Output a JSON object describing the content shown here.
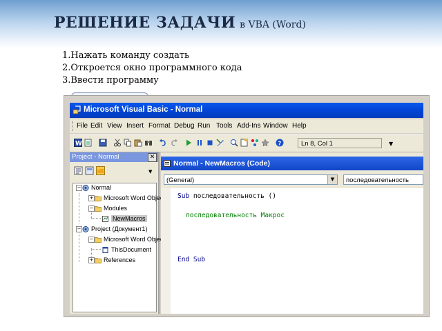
{
  "slide": {
    "title_main": "РЕШЕНИЕ ЗАДАЧИ",
    "title_sub": "в VBA (Word)",
    "steps": [
      "1.Нажать команду создать",
      "2.Откроется окно программного кода",
      "3.Ввести программу"
    ]
  },
  "window": {
    "title": "Microsoft Visual Basic - Normal",
    "menu": [
      "File",
      "Edit",
      "View",
      "Insert",
      "Format",
      "Debug",
      "Run",
      "Tools",
      "Add-Ins",
      "Window",
      "Help"
    ],
    "status_position": "Ln 8, Col 1"
  },
  "project_pane": {
    "title": "Project - Normal",
    "tree": [
      {
        "label": "Normal"
      },
      {
        "label": "Microsoft Word Objects"
      },
      {
        "label": "Modules"
      },
      {
        "label": "NewMacros"
      },
      {
        "label": "Project (Документ1)"
      },
      {
        "label": "Microsoft Word Objects"
      },
      {
        "label": "ThisDocument"
      },
      {
        "label": "References"
      }
    ]
  },
  "code_window": {
    "title": "Normal - NewMacros (Code)",
    "object_dropdown": "(General)",
    "procedure_dropdown": "последовательность",
    "lines": {
      "sub_kw": "Sub",
      "sub_rest": " последовательность ()",
      "comment": "последовательность Макрос",
      "end_kw": "End Sub"
    }
  },
  "colors": {
    "titlebar": "#0a58ec",
    "keyword": "#00008b",
    "comment": "#008000",
    "chrome": "#ece9d8"
  },
  "icons": [
    "vba-app-icon",
    "word-icon",
    "save-icon",
    "cut-icon",
    "copy-icon",
    "paste-icon",
    "find-icon",
    "undo-icon",
    "redo-icon",
    "run-icon",
    "pause-icon",
    "stop-icon",
    "design-mode-icon",
    "project-explorer-icon",
    "properties-icon",
    "object-browser-icon",
    "toolbox-icon",
    "help-icon",
    "view-code-icon",
    "view-object-icon",
    "toggle-folders-icon",
    "folder-icon",
    "module-icon",
    "document-icon"
  ]
}
